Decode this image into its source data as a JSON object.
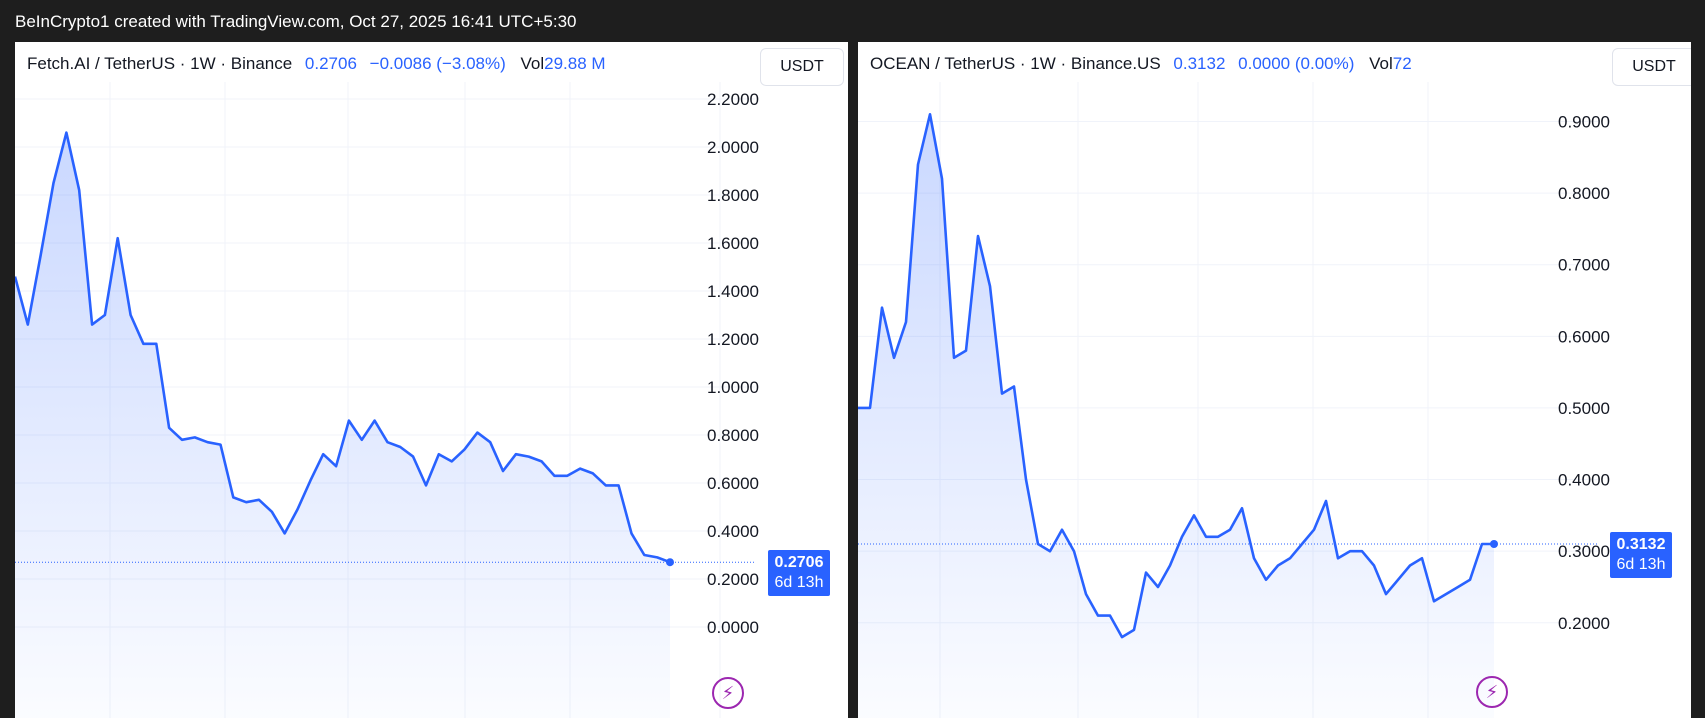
{
  "header": {
    "title": "BeInCrypto1 created with TradingView.com, Oct 27, 2025 16:41 UTC+5:30"
  },
  "chart_data": [
    {
      "type": "area",
      "symbol": "Fetch.AI / TetherUS · 1W · Binance",
      "last_price": "0.2706",
      "change": "−0.0086 (−3.08%)",
      "vol_label": "Vol",
      "vol_value": "29.88 M",
      "currency": "USDT",
      "countdown": "6d 13h",
      "ylim": [
        0,
        2.2
      ],
      "y_ticks": [
        "0.0000",
        "0.2000",
        "0.4000",
        "0.6000",
        "0.8000",
        "1.0000",
        "1.2000",
        "1.4000",
        "1.6000",
        "1.8000",
        "2.0000",
        "2.2000"
      ],
      "values": [
        1.46,
        1.26,
        1.55,
        1.85,
        2.06,
        1.82,
        1.26,
        1.3,
        1.62,
        1.3,
        1.18,
        1.18,
        0.83,
        0.78,
        0.79,
        0.77,
        0.76,
        0.54,
        0.52,
        0.53,
        0.48,
        0.39,
        0.49,
        0.61,
        0.72,
        0.67,
        0.86,
        0.78,
        0.86,
        0.77,
        0.75,
        0.71,
        0.59,
        0.72,
        0.69,
        0.74,
        0.81,
        0.77,
        0.65,
        0.72,
        0.71,
        0.69,
        0.63,
        0.63,
        0.66,
        0.64,
        0.59,
        0.59,
        0.39,
        0.3,
        0.29,
        0.27
      ],
      "color": "#2962ff"
    },
    {
      "type": "area",
      "symbol": "OCEAN / TetherUS · 1W · Binance.US",
      "last_price": "0.3132",
      "change": "0.0000 (0.00%)",
      "vol_label": "Vol",
      "vol_value": "72",
      "currency": "USDT",
      "countdown": "6d 13h",
      "ylim": [
        0.155,
        0.93
      ],
      "y_ticks": [
        "0.2000",
        "0.3000",
        "0.4000",
        "0.5000",
        "0.6000",
        "0.7000",
        "0.8000",
        "0.9000"
      ],
      "values": [
        0.5,
        0.5,
        0.64,
        0.57,
        0.62,
        0.84,
        0.91,
        0.82,
        0.57,
        0.58,
        0.74,
        0.67,
        0.52,
        0.53,
        0.4,
        0.31,
        0.3,
        0.33,
        0.3,
        0.24,
        0.21,
        0.21,
        0.18,
        0.19,
        0.27,
        0.25,
        0.28,
        0.32,
        0.35,
        0.32,
        0.32,
        0.33,
        0.36,
        0.29,
        0.26,
        0.28,
        0.29,
        0.31,
        0.33,
        0.37,
        0.29,
        0.3,
        0.3,
        0.28,
        0.24,
        0.26,
        0.28,
        0.29,
        0.23,
        0.24,
        0.25,
        0.26,
        0.31,
        0.31
      ],
      "color": "#2962ff"
    }
  ]
}
